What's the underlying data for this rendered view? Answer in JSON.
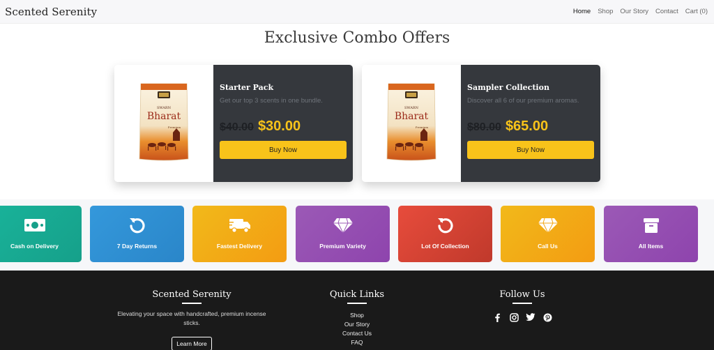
{
  "navbar": {
    "brand": "Scented Serenity",
    "links": [
      "Home",
      "Shop",
      "Our Story",
      "Contact",
      "Cart (0)"
    ]
  },
  "page_title": "Exclusive Combo Offers",
  "cards": [
    {
      "title": "Starter Pack",
      "description": "Get our top 3 scents in one bundle.",
      "old_price": "$40.00",
      "new_price": "$30.00",
      "button": "Buy Now",
      "product_text": {
        "brand_top": "SWARN",
        "brand_main": "Bharat",
        "sub": "Premium"
      }
    },
    {
      "title": "Sampler Collection",
      "description": "Discover all 6 of our premium aromas.",
      "old_price": "$80.00",
      "new_price": "$65.00",
      "button": "Buy Now",
      "product_text": {
        "brand_top": "SWARN",
        "brand_main": "Bharat",
        "sub": "Premium"
      }
    }
  ],
  "features": [
    {
      "label": "Cash on Delivery",
      "icon": "money-icon",
      "color": "#1abc9c"
    },
    {
      "label": "7 Day Returns",
      "icon": "undo-icon",
      "color": "#3498db"
    },
    {
      "label": "Fastest Delivery",
      "icon": "truck-icon",
      "color": "#f39c12"
    },
    {
      "label": "Premium Variety",
      "icon": "gem-icon",
      "color": "#9b59b6"
    },
    {
      "label": "Lot Of Collection",
      "icon": "undo-icon",
      "color": "#e74c3c"
    },
    {
      "label": "Call Us",
      "icon": "gem-icon",
      "color": "#f39c12"
    },
    {
      "label": "All Items",
      "icon": "box-icon",
      "color": "#9b59b6"
    }
  ],
  "footer": {
    "about": {
      "title": "Scented Serenity",
      "text": "Elevating your space with handcrafted, premium incense sticks.",
      "button": "Learn More"
    },
    "quick_links": {
      "title": "Quick Links",
      "links": [
        "Shop",
        "Our Story",
        "Contact Us",
        "FAQ"
      ]
    },
    "follow": {
      "title": "Follow Us",
      "icons": [
        "facebook-icon",
        "instagram-icon",
        "twitter-icon",
        "pinterest-icon"
      ]
    }
  },
  "colors": {
    "accent": "#f8c31a",
    "card_dark": "#35383d",
    "footer_bg": "#1a1a1a"
  }
}
